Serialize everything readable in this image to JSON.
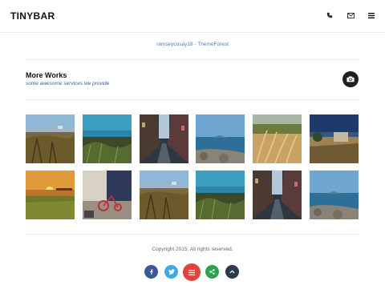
{
  "header": {
    "logo": "TINYBAR",
    "icons": [
      "phone-icon",
      "mail-icon",
      "menu-icon"
    ]
  },
  "credit": "ramseycosay18 - ThemeForest",
  "section": {
    "title": "More Works",
    "subtitle": "some awesome services we provide",
    "action_icon": "camera-icon"
  },
  "gallery": {
    "rows": [
      [
        "grass-field",
        "coast-bay",
        "city-street",
        "sea-coast",
        "wheat-field",
        "country-house"
      ],
      [
        "sunset-meadow",
        "tricycle-wall",
        "grass-field",
        "coast-bay",
        "city-street",
        "sea-coast"
      ]
    ]
  },
  "footer": {
    "copyright": "Copyright 2015. All rights reserved.",
    "social": [
      {
        "icon": "facebook-icon",
        "color": "#3b5998"
      },
      {
        "icon": "twitter-icon",
        "color": "#3fa9e0"
      },
      {
        "icon": "menu-icon",
        "color": "#e0443c"
      },
      {
        "icon": "share-icon",
        "color": "#2fa04f"
      },
      {
        "icon": "arrow-up-icon",
        "color": "#2b3a4d"
      }
    ]
  },
  "colors": {
    "link": "#4a7ec0",
    "subtitle": "#3c5fa8",
    "dark_button": "#1f1f1f"
  }
}
